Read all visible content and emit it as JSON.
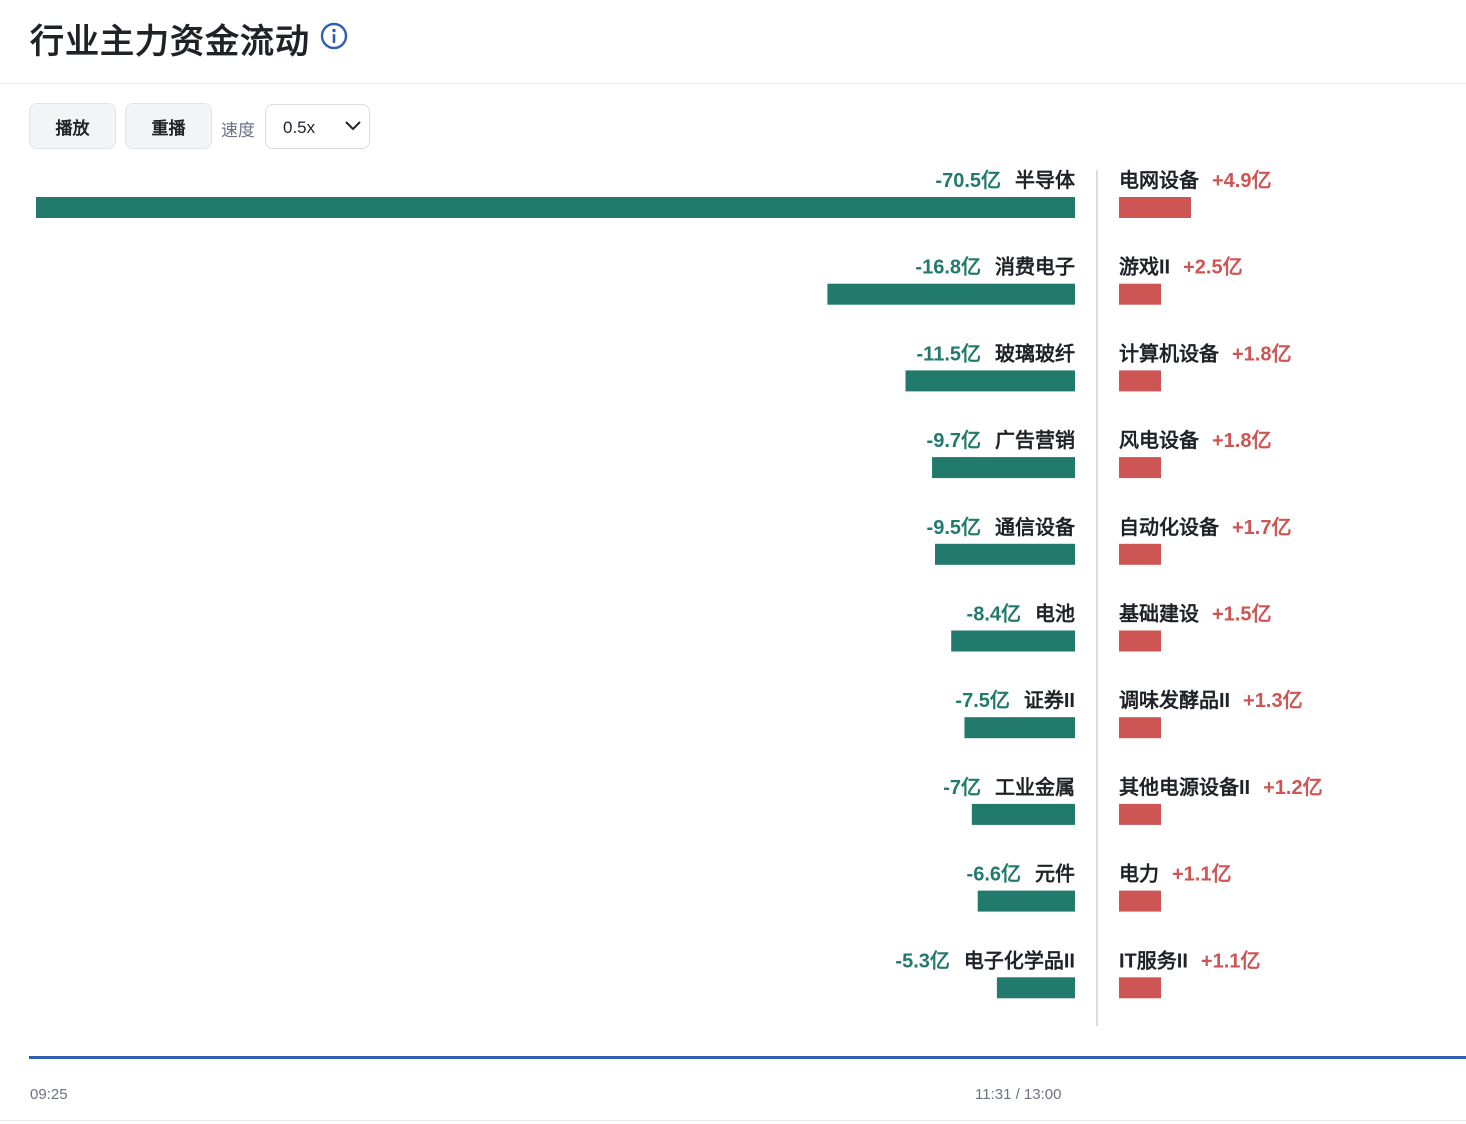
{
  "header": {
    "title": "行业主力资金流动",
    "info_icon": "info-icon"
  },
  "controls": {
    "play_label": "播放",
    "replay_label": "重播",
    "speed_label": "速度",
    "speed_value": "0.5x",
    "speed_icon": "chevron-down-icon"
  },
  "timeline": {
    "start": "09:25",
    "current": "11:31 / 13:00",
    "progress": 1.0
  },
  "colors": {
    "outflow": "#217a6b",
    "inflow": "#cd5553",
    "divider": "#d8dbe0",
    "accent": "#2f5fb3"
  },
  "chart_data": {
    "type": "bar",
    "unit": "亿",
    "outflow": [
      {
        "name": "半导体",
        "value": -70.5,
        "label": "-70.5亿"
      },
      {
        "name": "消费电子",
        "value": -16.8,
        "label": "-16.8亿"
      },
      {
        "name": "玻璃玻纤",
        "value": -11.5,
        "label": "-11.5亿"
      },
      {
        "name": "广告营销",
        "value": -9.7,
        "label": "-9.7亿"
      },
      {
        "name": "通信设备",
        "value": -9.5,
        "label": "-9.5亿"
      },
      {
        "name": "电池",
        "value": -8.4,
        "label": "-8.4亿"
      },
      {
        "name": "证券II",
        "value": -7.5,
        "label": "-7.5亿"
      },
      {
        "name": "工业金属",
        "value": -7.0,
        "label": "-7亿"
      },
      {
        "name": "元件",
        "value": -6.6,
        "label": "-6.6亿"
      },
      {
        "name": "电子化学品II",
        "value": -5.3,
        "label": "-5.3亿"
      }
    ],
    "inflow": [
      {
        "name": "电网设备",
        "value": 4.9,
        "label": "+4.9亿"
      },
      {
        "name": "游戏II",
        "value": 2.5,
        "label": "+2.5亿"
      },
      {
        "name": "计算机设备",
        "value": 1.8,
        "label": "+1.8亿"
      },
      {
        "name": "风电设备",
        "value": 1.8,
        "label": "+1.8亿"
      },
      {
        "name": "自动化设备",
        "value": 1.7,
        "label": "+1.7亿"
      },
      {
        "name": "基础建设",
        "value": 1.5,
        "label": "+1.5亿"
      },
      {
        "name": "调味发酵品II",
        "value": 1.3,
        "label": "+1.3亿"
      },
      {
        "name": "其他电源设备II",
        "value": 1.2,
        "label": "+1.2亿"
      },
      {
        "name": "电力",
        "value": 1.1,
        "label": "+1.1亿"
      },
      {
        "name": "IT服务II",
        "value": 1.1,
        "label": "+1.1亿"
      }
    ]
  }
}
